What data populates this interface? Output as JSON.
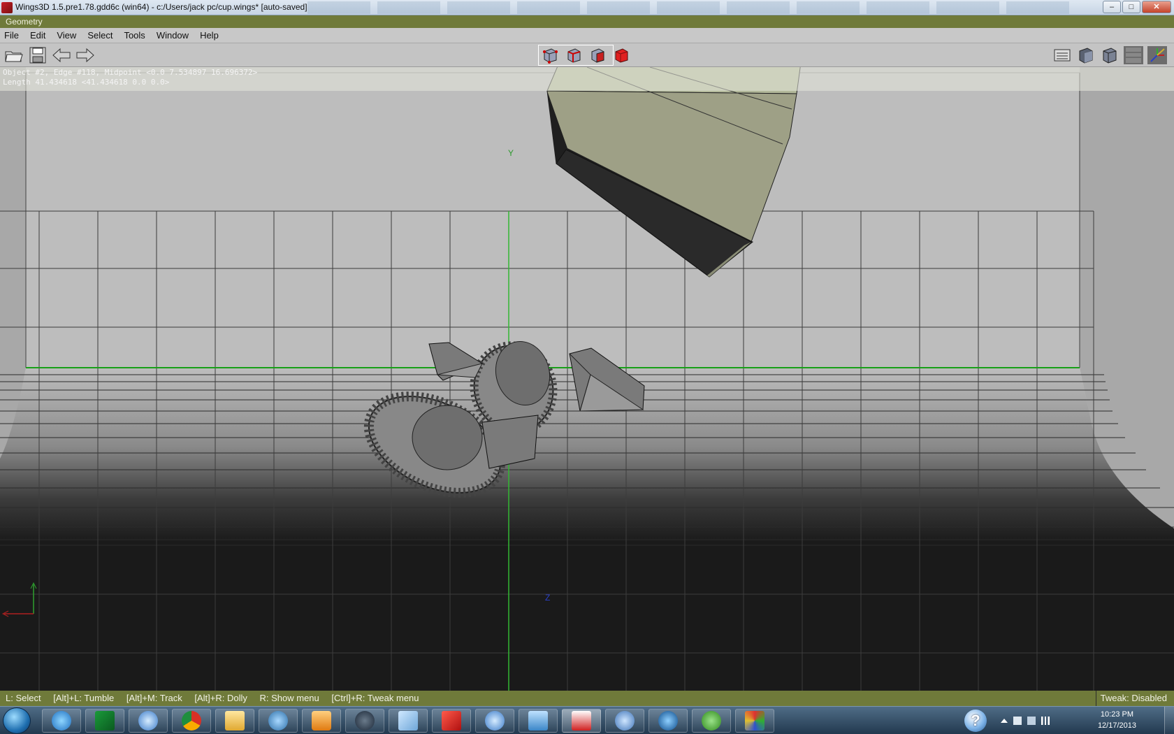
{
  "window": {
    "title": "Wings3D 1.5.pre1.78.gdd6c (win64) - c:/Users/jack pc/cup.wings* [auto-saved]",
    "minimize": "–",
    "maximize": "□",
    "close": "✕"
  },
  "geometry_header": "Geometry",
  "menu": [
    "File",
    "Edit",
    "View",
    "Select",
    "Tools",
    "Window",
    "Help"
  ],
  "toolbar": {
    "left_icons": [
      "open-folder-icon",
      "save-icon",
      "undo-arrow-icon",
      "redo-arrow-icon"
    ],
    "selection_modes": [
      "vertex-mode-icon",
      "edge-mode-icon",
      "face-mode-icon",
      "object-mode-icon"
    ],
    "right_icons": [
      "views-icon",
      "smooth-shade-icon",
      "flat-shade-icon",
      "wireframe-toggle-icon",
      "axes-icon"
    ]
  },
  "viewport": {
    "info_line1": "Object #2, Edge #118, Midpoint <0.0  7.534897  16.696372>",
    "info_line2": "Length 41.434618  <41.434618  0.0  0.0>",
    "axis_y_label": "Y",
    "axis_z_label": "Z",
    "colors": {
      "background": "#bdbdbd",
      "grid": "#3c3c3c",
      "y_axis": "#33b833",
      "horizon": "#18a018",
      "floor": "#1a1a1a"
    }
  },
  "statusbar": {
    "hints": [
      "L: Select",
      "[Alt]+L: Tumble",
      "[Alt]+M: Track",
      "[Alt]+R: Dolly",
      "R: Show menu",
      "[Ctrl]+R: Tweak menu"
    ],
    "tweak": "Tweak: Disabled"
  },
  "taskbar": {
    "apps": [
      "internet-explorer-icon",
      "stock-chart-icon",
      "itunes-icon",
      "chrome-icon",
      "file-explorer-icon",
      "wifi-icon",
      "media-player-icon",
      "steam-icon",
      "notepad-icon",
      "sketchup-icon",
      "itunes-icon",
      "photo-viewer-icon",
      "erlang-icon",
      "network-icon",
      "google-earth-icon",
      "utorrent-icon",
      "wings3d-icon"
    ],
    "clock_time": "10:23 PM",
    "clock_date": "12/17/2013"
  }
}
